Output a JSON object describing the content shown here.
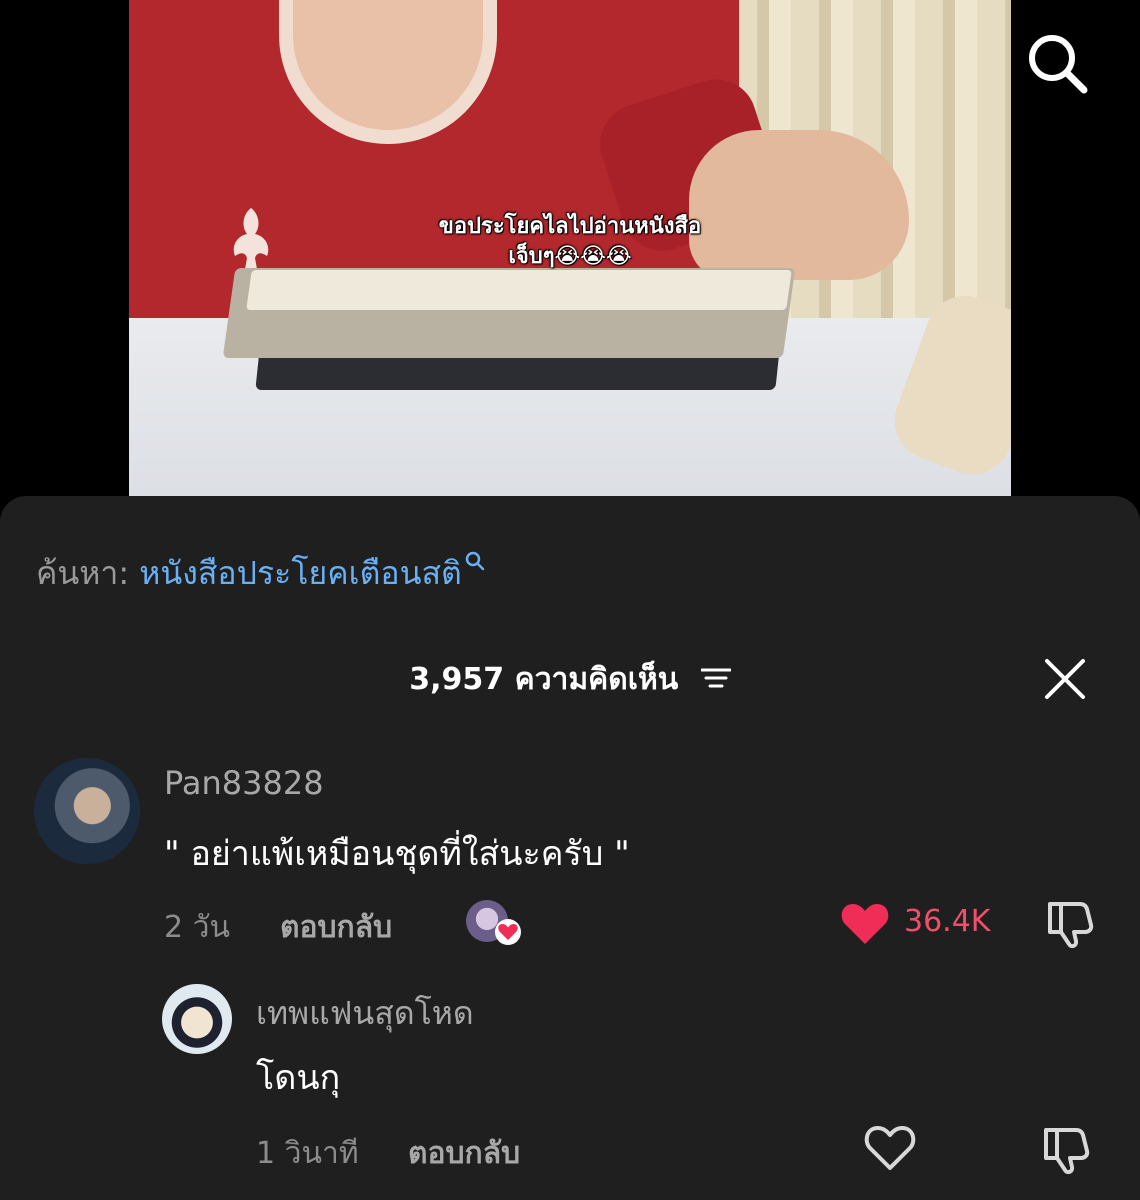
{
  "video": {
    "caption_line1": "ขอประโยคไลไปอ่านหนังสือ",
    "caption_line2": "เจ็บๆ😭😭😭"
  },
  "search_suggestion": {
    "label": "ค้นหา:",
    "query": "หนังสือประโยคเตือนสติ"
  },
  "comments_header": {
    "count": "3,957",
    "label": "ความคิดเห็น"
  },
  "comments": [
    {
      "username": "Pan83828",
      "text": "\" อย่าแพ้เหมือนชุดที่ใส่นะครับ \"",
      "time": "2 วัน",
      "reply_label": "ตอบกลับ",
      "likes": "36.4K",
      "liked_by_creator": true
    },
    {
      "username": "เทพแฟนสุดโหด",
      "text": "โดนกุ",
      "time": "1 วินาที",
      "reply_label": "ตอบกลับ"
    }
  ],
  "colors": {
    "sheet_bg": "#1f1f1f",
    "link_blue": "#6ab0f3",
    "like_red": "#ef4f6a"
  },
  "icons": [
    "search-icon",
    "sort-icon",
    "close-icon",
    "heart-filled-icon",
    "heart-outline-icon",
    "dislike-icon"
  ]
}
